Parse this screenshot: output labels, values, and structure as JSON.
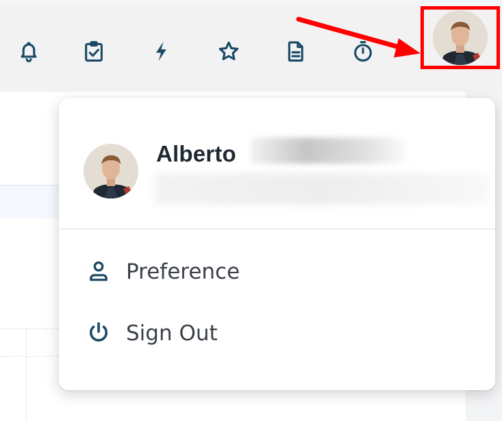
{
  "toolbar": {
    "icons": [
      "bell-icon",
      "clipboard-check-icon",
      "lightning-icon",
      "star-icon",
      "document-icon",
      "stopwatch-icon"
    ],
    "icon_color": "#1c4a66"
  },
  "annotation": {
    "highlight_color": "#ff0000"
  },
  "profile_menu": {
    "user": {
      "first_name": "Alberto"
    },
    "items": [
      {
        "label": "Preference",
        "icon": "user-icon"
      },
      {
        "label": "Sign Out",
        "icon": "power-icon"
      }
    ],
    "icon_color": "#1c4a66"
  }
}
